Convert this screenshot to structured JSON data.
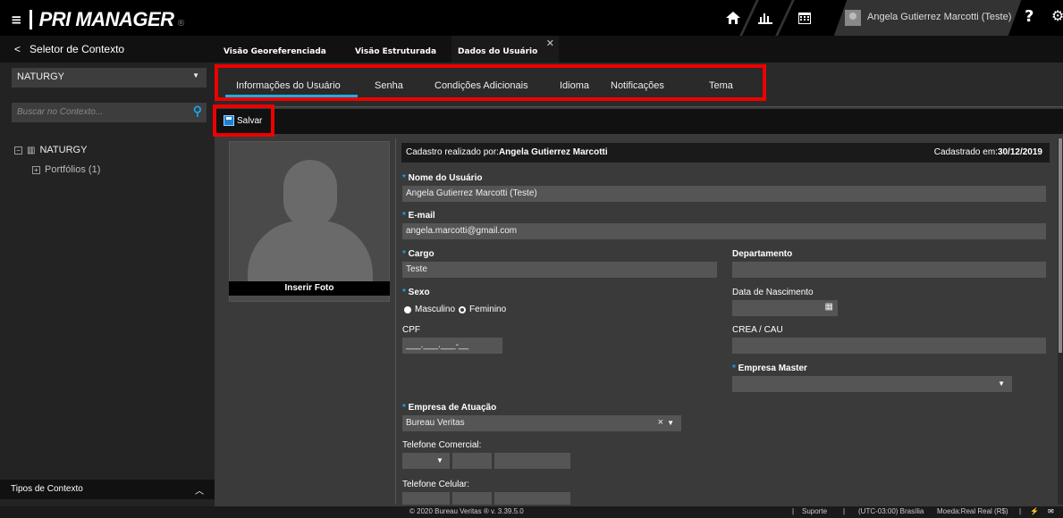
{
  "topbar": {
    "menu_glyph": "≡",
    "brand": "PRI MANAGER",
    "user": "Angela Gutierrez Marcotti (Teste)",
    "help": "?",
    "icons": [
      "home-icon",
      "chart-icon",
      "calendar-icon",
      "avatar-icon",
      "help-icon",
      "settings-icon"
    ]
  },
  "sidebar": {
    "header": "Seletor de Contexto",
    "back_glyph": "<",
    "context_select": "NATURGY",
    "search_placeholder": "Buscar no Contexto...",
    "tree": [
      {
        "label": "NATURGY"
      },
      {
        "label": "Portfólios (1)"
      }
    ],
    "footer": "Tipos de Contexto"
  },
  "tabs_top": [
    {
      "label": "Visão Georeferenciada"
    },
    {
      "label": "Visão Estruturada"
    },
    {
      "label": "Dados do Usuário"
    }
  ],
  "tabs_sub": [
    {
      "label": "Informações do Usuário"
    },
    {
      "label": "Senha"
    },
    {
      "label": "Condições Adicionais"
    },
    {
      "label": "Idioma"
    },
    {
      "label": "Notificações"
    },
    {
      "label": "Tema"
    }
  ],
  "toolbar": {
    "save": "Salvar"
  },
  "photo": {
    "insert": "Inserir Foto"
  },
  "form": {
    "cadastro_por_label": "Cadastro realizado por:",
    "cadastro_por": "Angela Gutierrez Marcotti",
    "cadastro_em_label": "Cadastrado em:",
    "cadastro_em": "30/12/2019",
    "nome_label": "Nome do Usuário",
    "nome": "Angela Gutierrez Marcotti (Teste)",
    "email_label": "E-mail",
    "email": "angela.marcotti@gmail.com",
    "cargo_label": "Cargo",
    "cargo": "Teste",
    "departamento_label": "Departamento",
    "departamento": "",
    "sexo_label": "Sexo",
    "sexo_options": [
      "Masculino",
      "Feminino"
    ],
    "nascimento_label": "Data de Nascimento",
    "cpf_label": "CPF",
    "cpf_mask": "___.___.___-__",
    "crea_label": "CREA / CAU",
    "empresa_master_label": "Empresa Master",
    "empresa_atuacao_label": "Empresa de Atuação",
    "empresa_atuacao": "Bureau Veritas",
    "clear_glyph": "×",
    "tel_com_label": "Telefone Comercial:",
    "tel_cel_label": "Telefone Celular:"
  },
  "footer": {
    "copyright": "© 2020 Bureau Veritas ®  v. 3.39.5.0",
    "suporte": "Suporte",
    "timezone": "(UTC-03:00) Brasília",
    "moeda": "Moeda:Real Real (R$)"
  }
}
